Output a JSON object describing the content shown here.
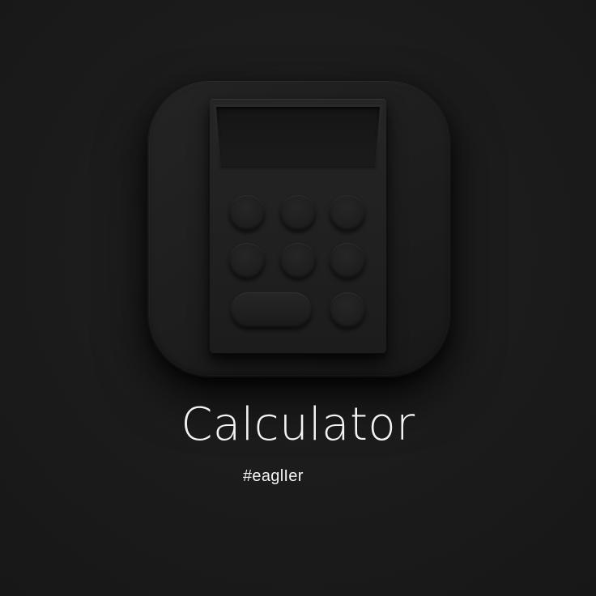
{
  "app": {
    "title": "Calculator",
    "tag": "#eaglIer"
  },
  "icon": {
    "name": "calculator-icon",
    "style": "dark skeuomorphic app icon",
    "keys": [
      {
        "name": "key-1"
      },
      {
        "name": "key-2"
      },
      {
        "name": "key-3"
      },
      {
        "name": "key-4"
      },
      {
        "name": "key-5"
      },
      {
        "name": "key-6"
      },
      {
        "name": "key-wide"
      },
      {
        "name": "key-7"
      }
    ]
  },
  "colors": {
    "background": "#1a1a1a",
    "icon_tile": "#212121",
    "text": "#f3f3f3"
  }
}
